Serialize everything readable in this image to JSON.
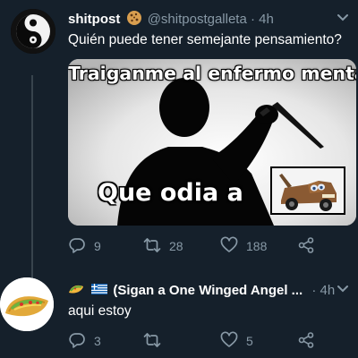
{
  "tweet1": {
    "display_name": "shitpost",
    "handle": "@shitpostgalleta",
    "separator": "·",
    "time": "4h",
    "text": "Quién puede tener semejante pensamiento?",
    "meme": {
      "top_text": "Traiganme al enfermo mental",
      "bottom_text": "Que odia a"
    },
    "replies": "9",
    "retweets": "28",
    "likes": "188"
  },
  "tweet2": {
    "display_name": "(Sigan a One Winged Angel ...",
    "separator": "·",
    "time": "4h",
    "text": "aqui estoy",
    "replies": "3",
    "retweets": "",
    "likes": "5"
  },
  "colors": {
    "background": "#15202b",
    "secondary_text": "#8899a6",
    "thread_line": "#38444d"
  },
  "icons": [
    "cookie-icon",
    "taco-icon",
    "greece-flag-icon",
    "reply-icon",
    "retweet-icon",
    "like-icon",
    "share-icon",
    "chevron-down-icon"
  ]
}
